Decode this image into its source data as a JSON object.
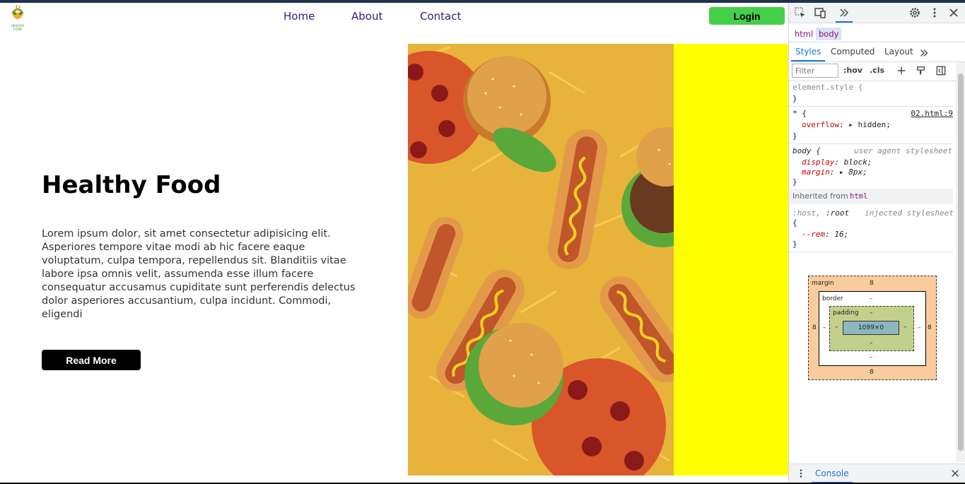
{
  "site": {
    "logo_text": "HEALTHY FOOD",
    "nav": [
      "Home",
      "About",
      "Contact"
    ],
    "login_label": "Login",
    "hero_title": "Healthy Food",
    "hero_text": "Lorem ipsum dolor, sit amet consectetur adipisicing elit. Asperiores tempore vitae modi ab hic facere eaque voluptatum, culpa tempora, repellendus sit. Blanditiis vitae labore ipsa omnis velit, assumenda esse illum facere consequatur accusamus cupiditate sunt perferendis delectus dolor asperiores accusantium, culpa incidunt. Commodi, eligendi",
    "read_more_label": "Read More",
    "accent_green": "#45d04a",
    "panel_yellow": "#ffff00"
  },
  "devtools": {
    "toolbar_icons": [
      "inspect-icon",
      "device-toggle-icon",
      "more-tabs-icon",
      "settings-icon",
      "kebab-menu-icon",
      "close-icon"
    ],
    "breadcrumbs": [
      "html",
      "body"
    ],
    "tabs": [
      "Styles",
      "Computed",
      "Layout"
    ],
    "filter_placeholder": "Filter",
    "hov": ":hov",
    "cls": ".cls",
    "rules": {
      "element_style": {
        "selector": "element.style {",
        "close": "}"
      },
      "universal": {
        "selector": "* {",
        "source": "02.html:9",
        "prop": "overflow",
        "value": "hidden;",
        "close": "}"
      },
      "body": {
        "selector": "body {",
        "origin": "user agent stylesheet",
        "props": [
          {
            "name": "display",
            "value": "block;"
          },
          {
            "name": "margin",
            "value": "8px;"
          }
        ],
        "close": "}"
      },
      "inherited_label": "Inherited from",
      "inherited_tag": "html",
      "host": {
        "selector_a": ":host,",
        "selector_b": ":root",
        "origin": "injected stylesheet",
        "open": "{",
        "prop": "--rem",
        "value": "16;",
        "close": "}"
      }
    },
    "box_model": {
      "margin_label": "margin",
      "border_label": "border",
      "padding_label": "padding",
      "margin_top": "8",
      "margin_bottom": "8",
      "margin_left": "8",
      "margin_right": "8",
      "border_top": "–",
      "border_bottom": "–",
      "border_left": "–",
      "border_right": "–",
      "padding_top": "–",
      "padding_bottom": "–",
      "padding_left": "–",
      "padding_right": "–",
      "content": "1099×0"
    },
    "console_tab": "Console"
  }
}
